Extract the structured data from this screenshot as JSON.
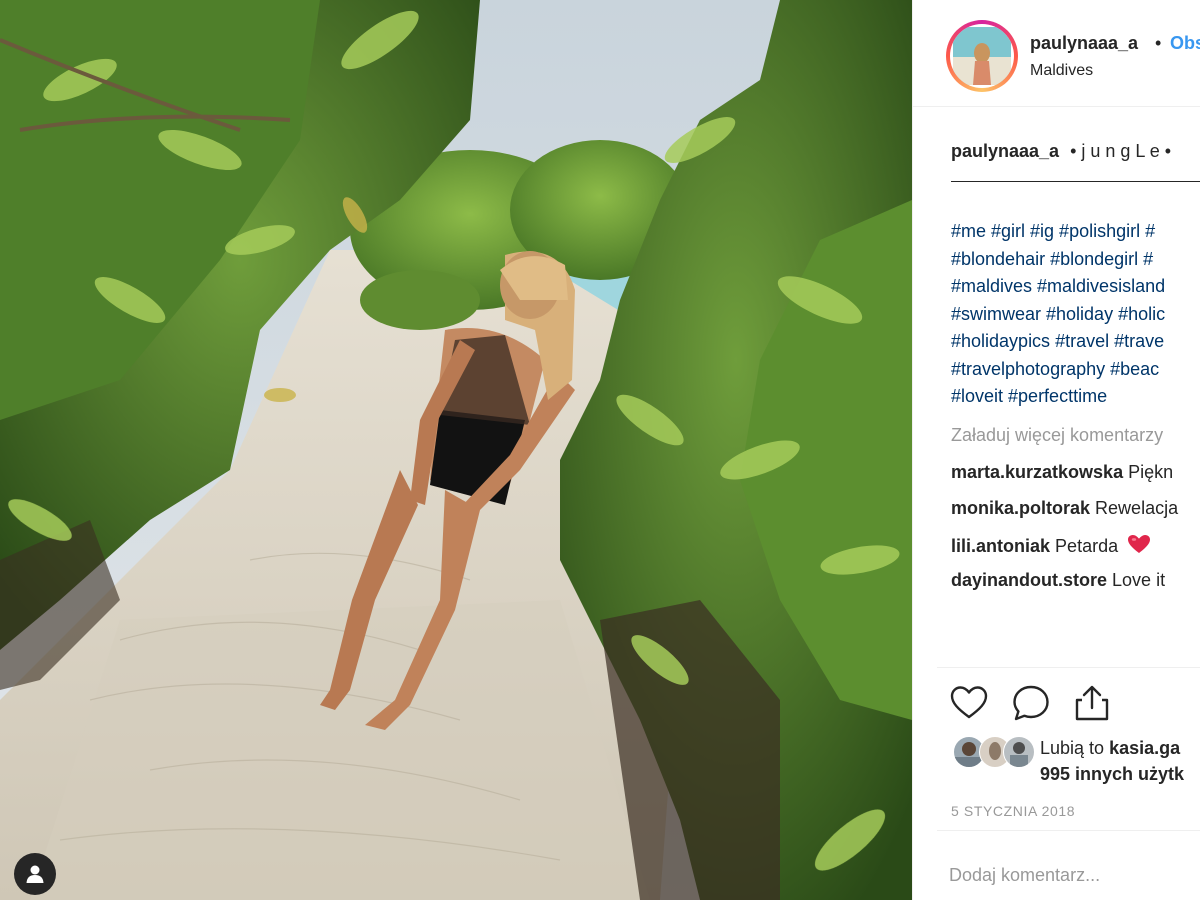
{
  "post": {
    "photo_alt": "",
    "author": {
      "username": "paulynaaa_a",
      "separator": "•",
      "follow_label": "Obs",
      "location": "Maldives"
    },
    "caption": {
      "username": "paulynaaa_a",
      "text": "• j u n g L e •"
    },
    "hashtag_lines": [
      "#me #girl #ig #polishgirl #",
      "#blondehair #blondegirl #",
      "#maldives #maldivesisland",
      "#swimwear #holiday #holic",
      "#holidaypics #travel #trave",
      "#travelphotography #beac",
      "#loveit #perfecttime"
    ],
    "load_more_label": "Załaduj więcej komentarzy",
    "comments": [
      {
        "user": "marta.kurzatkowska",
        "text": "Piękn"
      },
      {
        "user": "monika.poltorak",
        "text": "Rewelacja"
      },
      {
        "user": "lili.antoniak",
        "text": "Petarda"
      },
      {
        "user": "dayinandout.store",
        "text": "Love it"
      }
    ],
    "comment_emoji": "red-heart",
    "likes": {
      "prefix": "Lubią to",
      "first_liker": "kasia.ga",
      "others": "995 innych użytk"
    },
    "date": "5 STYCZNIA 2018",
    "add_comment_placeholder": "Dodaj komentarz..."
  },
  "icons": {
    "like": "heart-outline-icon",
    "comment": "speech-bubble-icon",
    "share": "share-upload-icon",
    "tag_user": "user-silhouette-icon"
  },
  "colors": {
    "link_blue": "#3897f0",
    "hashtag_blue": "#003569",
    "muted_grey": "#999999",
    "text": "#262626",
    "heart_red": "#e0264b"
  }
}
